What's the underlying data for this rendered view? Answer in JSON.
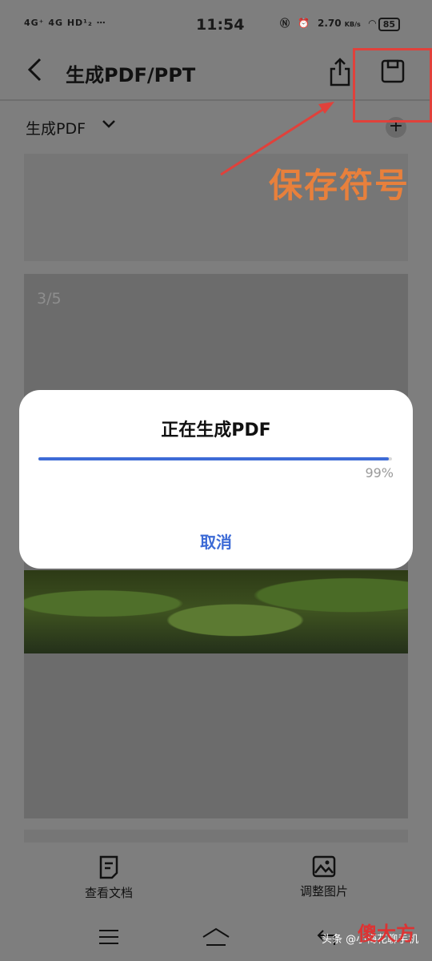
{
  "status_bar": {
    "signals": "4G⁺  4G  HD¹₂  ⋯",
    "time": "11:54",
    "speed": "2.70",
    "speed_unit": "KB/s",
    "battery": "85"
  },
  "header": {
    "title": "生成PDF/PPT",
    "back_icon": "back-arrow-icon",
    "share_icon": "share-icon",
    "save_icon": "save-icon"
  },
  "subbar": {
    "label": "生成PDF",
    "dropdown_icon": "chevron-down-icon",
    "add_icon": "plus-icon"
  },
  "pages": {
    "page_indicator": "3/5"
  },
  "annotation": {
    "text": "保存符号",
    "color": "#e0413b"
  },
  "dialog": {
    "title": "正在生成PDF",
    "progress_fraction": 0.99,
    "percent_text": "99%",
    "cancel_label": "取消",
    "accent_color": "#3d6bd6"
  },
  "bottom_nav": {
    "items": [
      {
        "label": "查看文档",
        "icon": "document-icon"
      },
      {
        "label": "调整图片",
        "icon": "image-icon"
      }
    ]
  },
  "system_nav": {
    "menu_icon": "menu-icon",
    "home_icon": "home-icon",
    "back_icon": "return-icon"
  },
  "watermark": {
    "text": "头条 @小梅花聊手机",
    "logo": "傻大方"
  }
}
